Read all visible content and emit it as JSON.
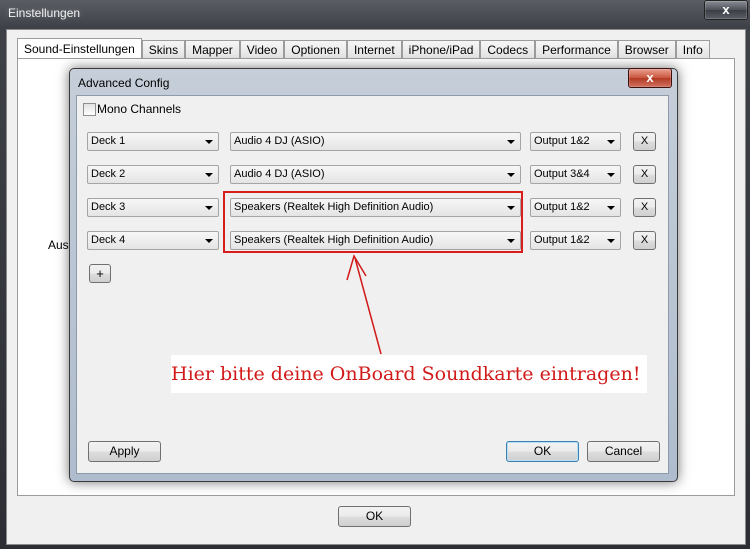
{
  "window": {
    "title": "Einstellungen",
    "close_glyph": "x",
    "ok_label": "OK",
    "partial_label": "Ausg"
  },
  "tabs": [
    {
      "label": "Sound-Einstellungen",
      "active": true
    },
    {
      "label": "Skins"
    },
    {
      "label": "Mapper"
    },
    {
      "label": "Video"
    },
    {
      "label": "Optionen"
    },
    {
      "label": "Internet"
    },
    {
      "label": "iPhone/iPad"
    },
    {
      "label": "Codecs"
    },
    {
      "label": "Performance"
    },
    {
      "label": "Browser"
    },
    {
      "label": "Info"
    }
  ],
  "dialog": {
    "title": "Advanced Config",
    "close_glyph": "x",
    "mono_label": "Mono Channels",
    "mono_checked": false,
    "rows": [
      {
        "deck": "Deck 1",
        "device": "Audio 4 DJ (ASIO)",
        "output": "Output 1&2",
        "remove": "X"
      },
      {
        "deck": "Deck 2",
        "device": "Audio 4 DJ (ASIO)",
        "output": "Output 3&4",
        "remove": "X"
      },
      {
        "deck": "Deck 3",
        "device": "Speakers (Realtek High Definition Audio)",
        "output": "Output 1&2",
        "remove": "X"
      },
      {
        "deck": "Deck 4",
        "device": "Speakers (Realtek High Definition Audio)",
        "output": "Output 1&2",
        "remove": "X"
      }
    ],
    "add_label": "+",
    "annotation": "Hier bitte deine OnBoard Soundkarte eintragen!",
    "apply_label": "Apply",
    "ok_label": "OK",
    "cancel_label": "Cancel"
  },
  "colors": {
    "annotation_red": "#d11a1a",
    "close_red": "#c9543c"
  }
}
